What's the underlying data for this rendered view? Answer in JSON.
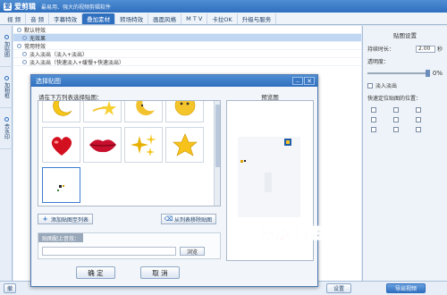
{
  "app": {
    "title": "爱剪辑",
    "subtitle": "最易用、强大的视频剪辑软件",
    "logo_letter": "爱"
  },
  "tabs": [
    "视 频",
    "音 频",
    "字幕特效",
    "叠加素材",
    "转场特效",
    "画面风格",
    "M T V",
    "卡拉OK",
    "升级与服务"
  ],
  "active_tab_index": 3,
  "left_nav": [
    "加贴图",
    "加相框",
    "去水印"
  ],
  "main_list": [
    {
      "label": "默认特效",
      "type": "group"
    },
    {
      "label": "无效果",
      "type": "item",
      "selected": true
    },
    {
      "label": "常用特效",
      "type": "group"
    },
    {
      "label": "淡入淡出（淡入+淡出）",
      "type": "item"
    },
    {
      "label": "淡入淡出（快速淡入+缓慢+快速淡出）",
      "type": "item"
    }
  ],
  "sidebar": {
    "header": "贴图设置",
    "duration_label": "持续时长：",
    "duration_value": "2.00",
    "duration_unit": "秒",
    "opacity_label": "透明度：",
    "opacity_value": "0%",
    "fade_label": "淡入淡出",
    "position_label": "快速定位贴图的位置："
  },
  "dialog": {
    "title": "选择贴图",
    "instruction": "请在下方列表选择贴图：",
    "preview_label": "预览图",
    "add_to_list": "添加贴图至列表",
    "delete_from_list": "从列表移除贴图",
    "audio_label": "贴图配上音效：",
    "browse": "浏览",
    "ok": "确 定",
    "cancel": "取 消",
    "stickers": [
      "moon-yellow",
      "shooting-star",
      "moon-sleepy",
      "moon-face",
      "red-heart",
      "red-lips",
      "gold-sparkles",
      "gold-star",
      "small-custom"
    ]
  },
  "overlay_text": "添加贴图",
  "bottom": {
    "left_button": "撤",
    "export": "导出视频",
    "settings_button": "设置"
  }
}
